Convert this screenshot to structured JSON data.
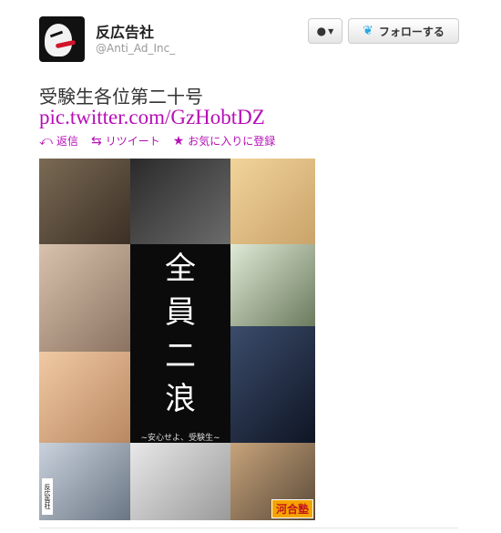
{
  "user": {
    "display_name": "反広告社",
    "screen_name": "@Anti_Ad_Inc_"
  },
  "buttons": {
    "user_dropdown_icon": "person-icon",
    "follow_label": "フォローする"
  },
  "tweet": {
    "text": "受験生各位第二十号",
    "link": "pic.twitter.com/GzHobtDZ"
  },
  "actions": [
    {
      "label": "返信",
      "icon": "reply-icon"
    },
    {
      "label": "リツイート",
      "icon": "retweet-icon"
    },
    {
      "label": "お気に入りに登録",
      "icon": "star-icon"
    }
  ],
  "collage": {
    "center_chars": [
      "全",
      "員",
      "二",
      "浪"
    ],
    "center_caption": "~安心せよ、受験生~",
    "brand_label": "河合塾",
    "stamp_label": "反広告社"
  },
  "colors": {
    "link": "#b60fb6",
    "twitter_bird": "#2ba9e1"
  }
}
